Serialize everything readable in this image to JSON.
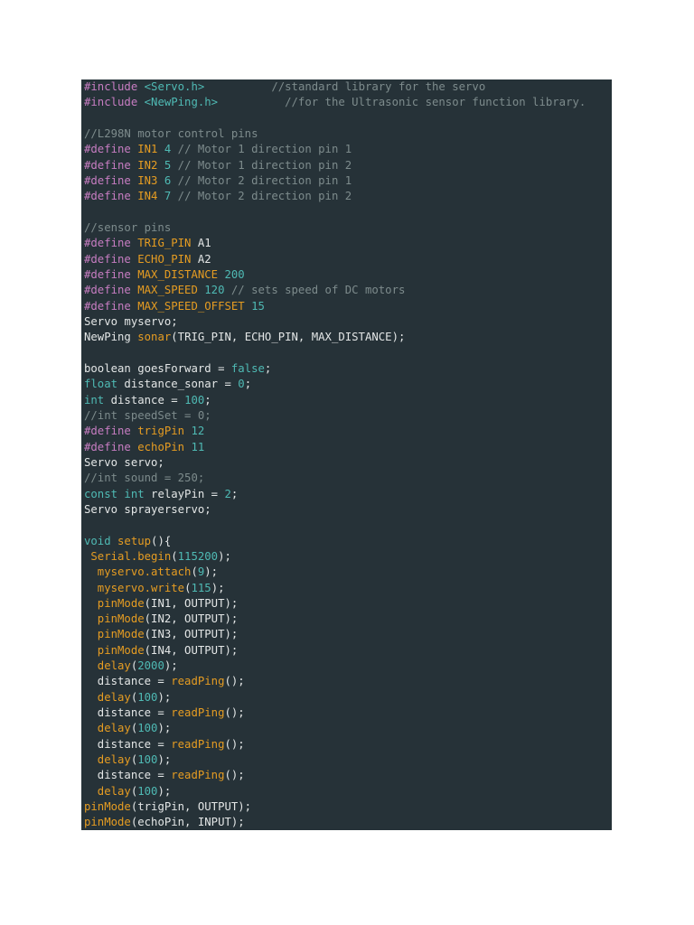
{
  "colors": {
    "background": "#263238",
    "preprocessor": "#c77dc2",
    "function": "#e59c22",
    "keyword_number": "#4fbab4",
    "comment": "#7d8b8c",
    "text": "#e3e6e6"
  },
  "lines": [
    [
      [
        "p",
        "#include "
      ],
      [
        "c",
        "<Servo.h>"
      ],
      [
        "t",
        "          "
      ],
      [
        "g",
        "//standard library for the servo"
      ]
    ],
    [
      [
        "p",
        "#include "
      ],
      [
        "c",
        "<NewPing.h>"
      ],
      [
        "t",
        "          "
      ],
      [
        "g",
        "//for the Ultrasonic sensor function library."
      ]
    ],
    [],
    [
      [
        "g",
        "//L298N motor control pins"
      ]
    ],
    [
      [
        "p",
        "#define "
      ],
      [
        "o",
        "IN1"
      ],
      [
        "c",
        " 4"
      ],
      [
        "g",
        " // Motor 1 direction pin 1"
      ]
    ],
    [
      [
        "p",
        "#define "
      ],
      [
        "o",
        "IN2"
      ],
      [
        "c",
        " 5"
      ],
      [
        "g",
        " // Motor 1 direction pin 2"
      ]
    ],
    [
      [
        "p",
        "#define "
      ],
      [
        "o",
        "IN3"
      ],
      [
        "c",
        " 6"
      ],
      [
        "g",
        " // Motor 2 direction pin 1"
      ]
    ],
    [
      [
        "p",
        "#define "
      ],
      [
        "o",
        "IN4"
      ],
      [
        "c",
        " 7"
      ],
      [
        "g",
        " // Motor 2 direction pin 2"
      ]
    ],
    [],
    [
      [
        "g",
        "//sensor pins"
      ]
    ],
    [
      [
        "p",
        "#define "
      ],
      [
        "o",
        "TRIG_PIN"
      ],
      [
        "t",
        " A1"
      ]
    ],
    [
      [
        "p",
        "#define "
      ],
      [
        "o",
        "ECHO_PIN"
      ],
      [
        "t",
        " A2"
      ]
    ],
    [
      [
        "p",
        "#define "
      ],
      [
        "o",
        "MAX_DISTANCE"
      ],
      [
        "c",
        " 200"
      ]
    ],
    [
      [
        "p",
        "#define "
      ],
      [
        "o",
        "MAX_SPEED"
      ],
      [
        "c",
        " 120"
      ],
      [
        "g",
        " // sets speed of DC motors"
      ]
    ],
    [
      [
        "p",
        "#define "
      ],
      [
        "o",
        "MAX_SPEED_OFFSET"
      ],
      [
        "c",
        " 15"
      ]
    ],
    [
      [
        "t",
        "Servo myservo;"
      ]
    ],
    [
      [
        "t",
        "NewPing "
      ],
      [
        "o",
        "sonar"
      ],
      [
        "t",
        "(TRIG_PIN, ECHO_PIN, MAX_DISTANCE);"
      ]
    ],
    [],
    [
      [
        "t",
        "boolean goesForward = "
      ],
      [
        "c",
        "false"
      ],
      [
        "t",
        ";"
      ]
    ],
    [
      [
        "c",
        "float"
      ],
      [
        "t",
        " distance_sonar = "
      ],
      [
        "c",
        "0"
      ],
      [
        "t",
        ";"
      ]
    ],
    [
      [
        "c",
        "int"
      ],
      [
        "t",
        " distance = "
      ],
      [
        "c",
        "100"
      ],
      [
        "t",
        ";"
      ]
    ],
    [
      [
        "g",
        "//int speedSet = 0;"
      ]
    ],
    [
      [
        "p",
        "#define "
      ],
      [
        "o",
        "trigPin"
      ],
      [
        "c",
        " 12"
      ]
    ],
    [
      [
        "p",
        "#define "
      ],
      [
        "o",
        "echoPin"
      ],
      [
        "c",
        " 11"
      ]
    ],
    [
      [
        "t",
        "Servo servo;"
      ]
    ],
    [
      [
        "g",
        "//int sound = 250;"
      ]
    ],
    [
      [
        "c",
        "const int"
      ],
      [
        "t",
        " relayPin = "
      ],
      [
        "c",
        "2"
      ],
      [
        "t",
        ";"
      ]
    ],
    [
      [
        "t",
        "Servo sprayerservo;"
      ]
    ],
    [],
    [
      [
        "c",
        "void"
      ],
      [
        "o",
        " setup"
      ],
      [
        "t",
        "(){"
      ]
    ],
    [
      [
        "o",
        " Serial.begin"
      ],
      [
        "t",
        "("
      ],
      [
        "c",
        "115200"
      ],
      [
        "t",
        ");"
      ]
    ],
    [
      [
        "o",
        "  myservo.attach"
      ],
      [
        "t",
        "("
      ],
      [
        "c",
        "9"
      ],
      [
        "t",
        ");"
      ]
    ],
    [
      [
        "o",
        "  myservo.write"
      ],
      [
        "t",
        "("
      ],
      [
        "c",
        "115"
      ],
      [
        "t",
        ");"
      ]
    ],
    [
      [
        "o",
        "  pinMode"
      ],
      [
        "t",
        "(IN1, OUTPUT);"
      ]
    ],
    [
      [
        "o",
        "  pinMode"
      ],
      [
        "t",
        "(IN2, OUTPUT);"
      ]
    ],
    [
      [
        "o",
        "  pinMode"
      ],
      [
        "t",
        "(IN3, OUTPUT);"
      ]
    ],
    [
      [
        "o",
        "  pinMode"
      ],
      [
        "t",
        "(IN4, OUTPUT);"
      ]
    ],
    [
      [
        "o",
        "  delay"
      ],
      [
        "t",
        "("
      ],
      [
        "c",
        "2000"
      ],
      [
        "t",
        ");"
      ]
    ],
    [
      [
        "t",
        "  distance = "
      ],
      [
        "o",
        "readPing"
      ],
      [
        "t",
        "();"
      ]
    ],
    [
      [
        "o",
        "  delay"
      ],
      [
        "t",
        "("
      ],
      [
        "c",
        "100"
      ],
      [
        "t",
        ");"
      ]
    ],
    [
      [
        "t",
        "  distance = "
      ],
      [
        "o",
        "readPing"
      ],
      [
        "t",
        "();"
      ]
    ],
    [
      [
        "o",
        "  delay"
      ],
      [
        "t",
        "("
      ],
      [
        "c",
        "100"
      ],
      [
        "t",
        ");"
      ]
    ],
    [
      [
        "t",
        "  distance = "
      ],
      [
        "o",
        "readPing"
      ],
      [
        "t",
        "();"
      ]
    ],
    [
      [
        "o",
        "  delay"
      ],
      [
        "t",
        "("
      ],
      [
        "c",
        "100"
      ],
      [
        "t",
        ");"
      ]
    ],
    [
      [
        "t",
        "  distance = "
      ],
      [
        "o",
        "readPing"
      ],
      [
        "t",
        "();"
      ]
    ],
    [
      [
        "o",
        "  delay"
      ],
      [
        "t",
        "("
      ],
      [
        "c",
        "100"
      ],
      [
        "t",
        ");"
      ]
    ],
    [
      [
        "o",
        "pinMode"
      ],
      [
        "t",
        "(trigPin, OUTPUT);"
      ]
    ],
    [
      [
        "o",
        "pinMode"
      ],
      [
        "t",
        "(echoPin, INPUT);"
      ]
    ]
  ]
}
